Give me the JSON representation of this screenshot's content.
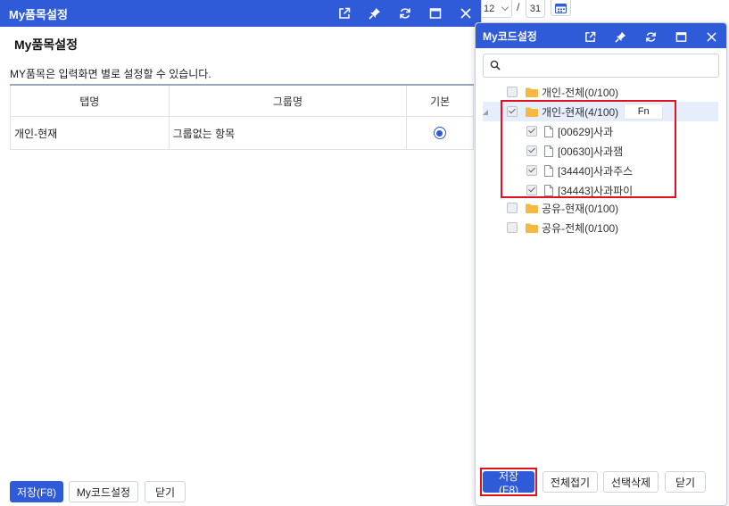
{
  "background": {
    "month_value": "12",
    "separator": "/",
    "day_value": "31"
  },
  "left_window": {
    "title": "My품목설정",
    "panel_title": "My품목설정",
    "description": "MY품목은 입력화면 별로 설정할 수 있습니다.",
    "columns": [
      "탭명",
      "그룹명",
      "기본"
    ],
    "rows": [
      {
        "tab": "개인-현재",
        "group": "그룹없는 항목",
        "default": true
      }
    ],
    "buttons": {
      "save": "저장(F8)",
      "my_code": "My코드설정",
      "close": "닫기"
    }
  },
  "right_window": {
    "title": "My코드설정",
    "search_placeholder": "",
    "tree": [
      {
        "label": "개인-전체(0/100)",
        "type": "folder",
        "checked": false
      },
      {
        "label": "개인-현재(4/100)",
        "type": "folder",
        "checked": true,
        "expanded": true,
        "fn": "Fn"
      },
      {
        "label": "[00629]사과",
        "type": "file",
        "checked": true
      },
      {
        "label": "[00630]사과잼",
        "type": "file",
        "checked": true
      },
      {
        "label": "[34440]사과주스",
        "type": "file",
        "checked": true
      },
      {
        "label": "[34443]사과파이",
        "type": "file",
        "checked": true
      },
      {
        "label": "공유-현재(0/100)",
        "type": "folder",
        "checked": false
      },
      {
        "label": "공유-전체(0/100)",
        "type": "folder",
        "checked": false
      }
    ],
    "buttons": {
      "save": "저장(F8)",
      "collapse_all": "전체접기",
      "delete_selected": "선택삭제",
      "close": "닫기"
    }
  },
  "colors": {
    "accent": "#2f5bd8",
    "highlight": "#e3101e",
    "folder": "#f5b841",
    "selected_row": "#e6eefb"
  },
  "icons": [
    "external-link-icon",
    "pin-icon",
    "refresh-icon",
    "maximize-icon",
    "close-icon",
    "search-icon",
    "folder-icon",
    "file-icon",
    "calendar-icon"
  ]
}
